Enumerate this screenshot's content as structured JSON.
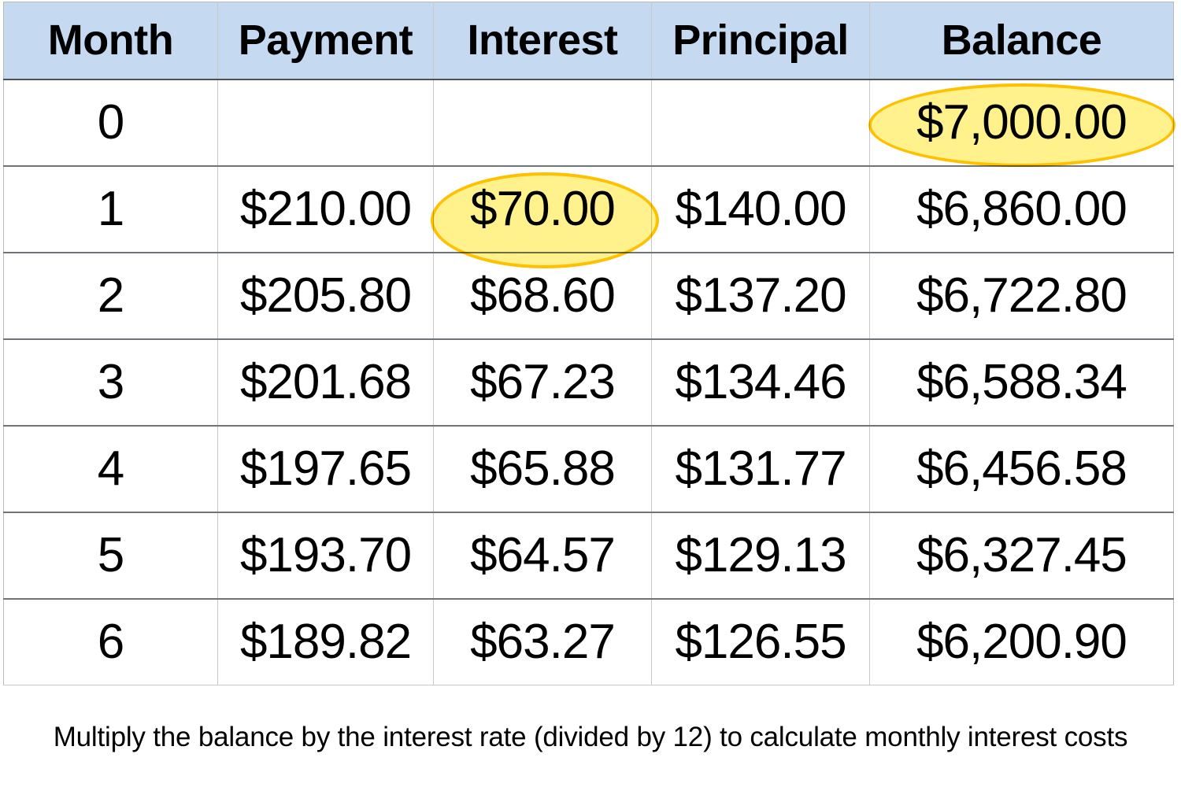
{
  "table": {
    "name": "loan-amortization-schedule",
    "headers": [
      "Month",
      "Payment",
      "Interest",
      "Principal",
      "Balance"
    ],
    "rows": [
      {
        "month": "0",
        "payment": "",
        "interest": "",
        "principal": "",
        "balance": "$7,000.00"
      },
      {
        "month": "1",
        "payment": "$210.00",
        "interest": "$70.00",
        "principal": "$140.00",
        "balance": "$6,860.00"
      },
      {
        "month": "2",
        "payment": "$205.80",
        "interest": "$68.60",
        "principal": "$137.20",
        "balance": "$6,722.80"
      },
      {
        "month": "3",
        "payment": "$201.68",
        "interest": "$67.23",
        "principal": "$134.46",
        "balance": "$6,588.34"
      },
      {
        "month": "4",
        "payment": "$197.65",
        "interest": "$65.88",
        "principal": "$131.77",
        "balance": "$6,456.58"
      },
      {
        "month": "5",
        "payment": "$193.70",
        "interest": "$64.57",
        "principal": "$129.13",
        "balance": "$6,327.45"
      },
      {
        "month": "6",
        "payment": "$189.82",
        "interest": "$63.27",
        "principal": "$126.55",
        "balance": "$6,200.90"
      }
    ]
  },
  "highlights": [
    {
      "id": "balance-month-0",
      "target_value": "$7,000.00",
      "shape": "ellipse"
    },
    {
      "id": "interest-month-1",
      "target_value": "$70.00",
      "shape": "ellipse"
    }
  ],
  "caption": {
    "text": "Multiply the balance by the interest rate (divided by 12) to calculate monthly interest costs"
  },
  "colors": {
    "header_background": "#c5d9f1",
    "header_text": "#000000",
    "cell_background": "#ffffff",
    "cell_text": "#000000",
    "grid_line": "#c9c9c9",
    "row_rule": "#6f7478",
    "highlight_fill": "#ffec5f",
    "highlight_stroke": "#ffc000",
    "caption_text": "#000000"
  }
}
